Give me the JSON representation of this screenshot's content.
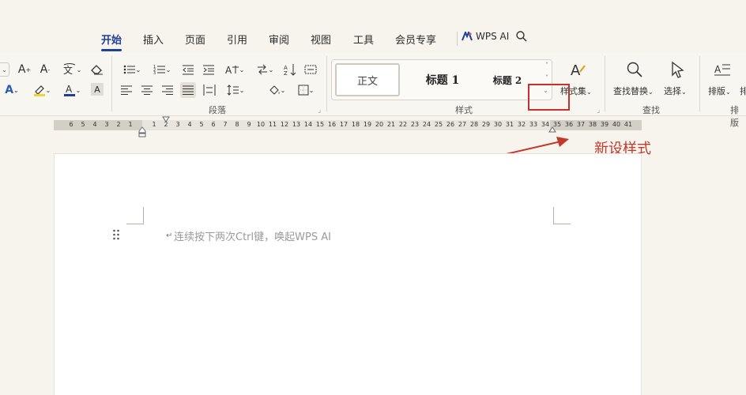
{
  "menu": {
    "tabs": [
      "开始",
      "插入",
      "页面",
      "引用",
      "审阅",
      "视图",
      "工具",
      "会员专享"
    ],
    "wps_ai": "WPS AI",
    "active_color": "#1e3f9a"
  },
  "ribbon": {
    "font_buttons": {
      "grow_font_sub": "+",
      "shrink_font_sub": "-",
      "char_shading": "A"
    },
    "paragraph_group": {
      "label": "段落"
    },
    "styles_group": {
      "label": "样式",
      "styles": [
        "正文",
        "标题 1",
        "标题 2"
      ],
      "style_set_label": "样式集"
    },
    "find_group": {
      "label": "查找",
      "find_replace_label": "查找替换",
      "select_label": "选择"
    },
    "layout_group": {
      "label": "排版",
      "layout_label": "排版",
      "truncated_label": "排"
    }
  },
  "ruler": {
    "left_ticks": [
      "6",
      "5",
      "4",
      "3",
      "2",
      "1"
    ],
    "right_ticks": [
      "1",
      "2",
      "3",
      "4",
      "5",
      "6",
      "7",
      "8",
      "9",
      "10",
      "11",
      "12",
      "13",
      "14",
      "15",
      "16",
      "17",
      "18",
      "19",
      "20",
      "21",
      "22",
      "23",
      "24",
      "25",
      "26",
      "27",
      "28",
      "29",
      "30",
      "31",
      "32",
      "33",
      "34",
      "35",
      "36",
      "37",
      "38",
      "39",
      "40",
      "41"
    ]
  },
  "annotation": {
    "text": "新设样式",
    "color": "#c0392b"
  },
  "document": {
    "placeholder": "连续按下两次Ctrl键，唤起WPS AI",
    "paragraph_mark": "↵"
  }
}
